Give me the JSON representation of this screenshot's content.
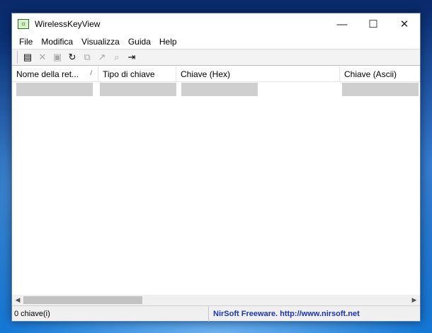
{
  "window": {
    "title": "WirelessKeyView",
    "app_icon": "wifi-key-icon",
    "controls": {
      "minimize": "—",
      "maximize": "☐",
      "close": "✕"
    }
  },
  "menu": [
    "File",
    "Modifica",
    "Visualizza",
    "Guida",
    "Help"
  ],
  "toolbar": [
    {
      "name": "properties-icon",
      "glyph": "▤",
      "enabled": true
    },
    {
      "name": "delete-icon",
      "glyph": "✕",
      "enabled": false
    },
    {
      "name": "save-icon",
      "glyph": "▣",
      "enabled": false
    },
    {
      "name": "refresh-icon",
      "glyph": "↻",
      "enabled": true
    },
    {
      "name": "copy-icon",
      "glyph": "⧉",
      "enabled": false
    },
    {
      "name": "export-icon",
      "glyph": "↗",
      "enabled": false
    },
    {
      "name": "find-icon",
      "glyph": "⌕",
      "enabled": false
    },
    {
      "name": "exit-icon",
      "glyph": "⇥",
      "enabled": true
    }
  ],
  "table": {
    "columns": [
      {
        "label": "Nome della ret...",
        "sorted": true
      },
      {
        "label": "Tipo di chiave",
        "sorted": false
      },
      {
        "label": "Chiave (Hex)",
        "sorted": false
      },
      {
        "label": "Chiave (Ascii)",
        "sorted": false
      }
    ],
    "sort_glyph": "/"
  },
  "status": {
    "count": "0 chiave(i)",
    "credit": "NirSoft Freeware.  http://www.nirsoft.net"
  },
  "colors": {
    "credit": "#1a33b8",
    "redacted": "#cfcfcf"
  }
}
